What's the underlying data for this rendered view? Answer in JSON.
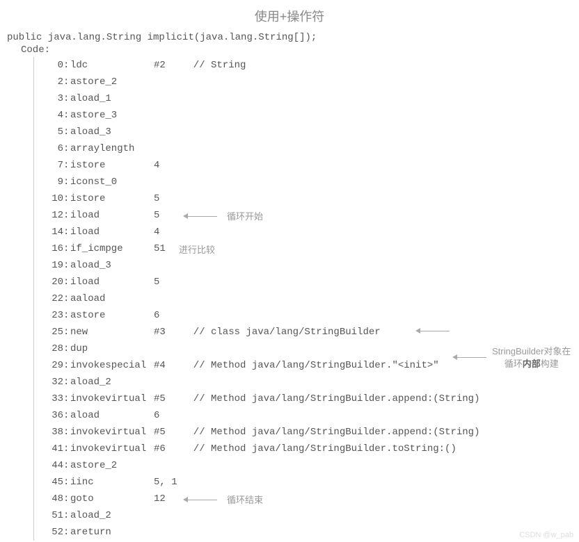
{
  "title": "使用+操作符",
  "signature": "public java.lang.String implicit(java.lang.String[]);",
  "codeLabel": "Code:",
  "annotations": {
    "loopStart": "循环开始",
    "compare": "进行比较",
    "loopEnd": "循环结束",
    "sideNote1": "StringBuilder对象在",
    "sideNote2a": "循环",
    "sideNote2b": "内部",
    "sideNote2c": "构建"
  },
  "watermark": "CSDN @w_pab",
  "lines": [
    {
      "offset": "0",
      "opcode": "ldc",
      "arg": "#2",
      "comment": "// String"
    },
    {
      "offset": "2",
      "opcode": "astore_2",
      "arg": "",
      "comment": ""
    },
    {
      "offset": "3",
      "opcode": "aload_1",
      "arg": "",
      "comment": ""
    },
    {
      "offset": "4",
      "opcode": "astore_3",
      "arg": "",
      "comment": ""
    },
    {
      "offset": "5",
      "opcode": "aload_3",
      "arg": "",
      "comment": ""
    },
    {
      "offset": "6",
      "opcode": "arraylength",
      "arg": "",
      "comment": ""
    },
    {
      "offset": "7",
      "opcode": "istore",
      "arg": "4",
      "comment": ""
    },
    {
      "offset": "9",
      "opcode": "iconst_0",
      "arg": "",
      "comment": ""
    },
    {
      "offset": "10",
      "opcode": "istore",
      "arg": "5",
      "comment": ""
    },
    {
      "offset": "12",
      "opcode": "iload",
      "arg": "5",
      "comment": "",
      "arrowNote": "loopStart"
    },
    {
      "offset": "14",
      "opcode": "iload",
      "arg": "4",
      "comment": ""
    },
    {
      "offset": "16",
      "opcode": "if_icmpge",
      "arg": "51",
      "comment": "",
      "inlineNote": "compare"
    },
    {
      "offset": "19",
      "opcode": "aload_3",
      "arg": "",
      "comment": ""
    },
    {
      "offset": "20",
      "opcode": "iload",
      "arg": "5",
      "comment": ""
    },
    {
      "offset": "22",
      "opcode": "aaload",
      "arg": "",
      "comment": ""
    },
    {
      "offset": "23",
      "opcode": "astore",
      "arg": "6",
      "comment": ""
    },
    {
      "offset": "25",
      "opcode": "new",
      "arg": "#3",
      "comment": "// class java/lang/StringBuilder",
      "sideArrow": true
    },
    {
      "offset": "28",
      "opcode": "dup",
      "arg": "",
      "comment": ""
    },
    {
      "offset": "29",
      "opcode": "invokespecial",
      "arg": "#4",
      "comment": "// Method java/lang/StringBuilder.\"<init>\""
    },
    {
      "offset": "32",
      "opcode": "aload_2",
      "arg": "",
      "comment": ""
    },
    {
      "offset": "33",
      "opcode": "invokevirtual",
      "arg": "#5",
      "comment": "// Method java/lang/StringBuilder.append:(String)"
    },
    {
      "offset": "36",
      "opcode": "aload",
      "arg": "6",
      "comment": ""
    },
    {
      "offset": "38",
      "opcode": "invokevirtual",
      "arg": "#5",
      "comment": "// Method java/lang/StringBuilder.append:(String)"
    },
    {
      "offset": "41",
      "opcode": "invokevirtual",
      "arg": "#6",
      "comment": "// Method java/lang/StringBuilder.toString:()"
    },
    {
      "offset": "44",
      "opcode": "astore_2",
      "arg": "",
      "comment": ""
    },
    {
      "offset": "45",
      "opcode": "iinc",
      "arg": "5, 1",
      "comment": ""
    },
    {
      "offset": "48",
      "opcode": "goto",
      "arg": "12",
      "comment": "",
      "arrowNote": "loopEnd"
    },
    {
      "offset": "51",
      "opcode": "aload_2",
      "arg": "",
      "comment": ""
    },
    {
      "offset": "52",
      "opcode": "areturn",
      "arg": "",
      "comment": ""
    }
  ]
}
